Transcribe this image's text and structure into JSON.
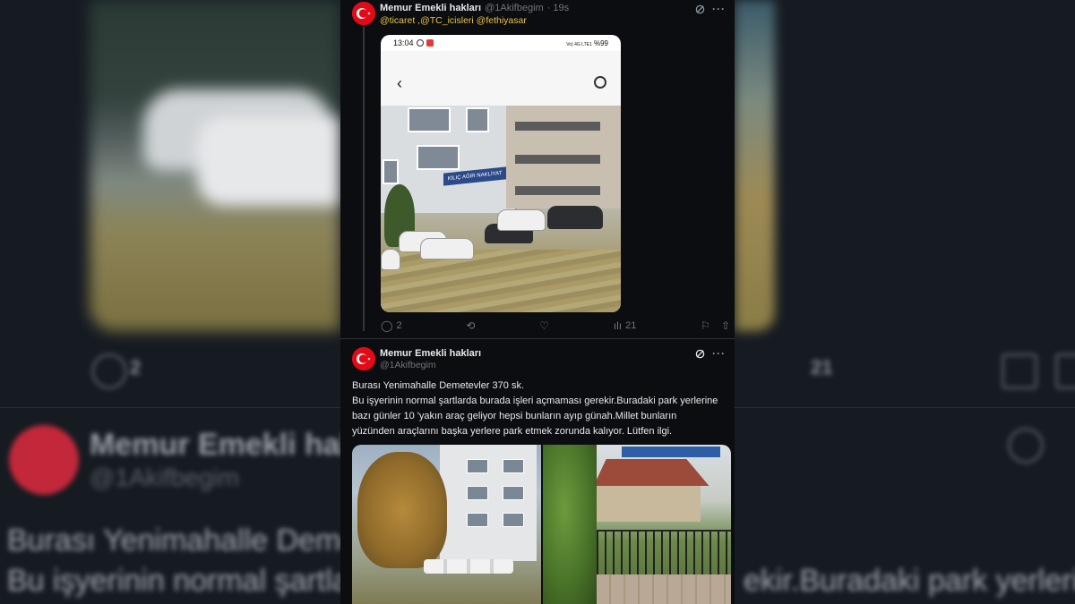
{
  "background": {
    "blur_name": "Memur Emekli hakl",
    "blur_handle": "@1Akifbegim",
    "blur_line1_left": "Burası Yenimahalle Deme",
    "blur_line2_left": "Bu işyerinin normal şartla",
    "blur_line1_right": "",
    "blur_line2_right": "ekir.Buradaki park yerlerine",
    "blur_reply_count": "2",
    "blur_views_count": "21"
  },
  "tweet1": {
    "author": "Memur Emekli hakları",
    "handle": "@1Akifbegim",
    "time": "· 19s",
    "mentions": "@ticaret ,@TC_icisleri @fethiyasar",
    "phone_time": "13:04",
    "phone_battery": "%99",
    "phone_signal": "Vo) 4G LTE1",
    "store_sign": "KILIÇ AĞIR NAKLİYAT",
    "replies": "2",
    "views": "21"
  },
  "tweet2": {
    "author": "Memur Emekli hakları",
    "handle": "@1Akifbegim",
    "lines": [
      "Burası Yenimahalle Demetevler 370 sk.",
      "Bu işyerinin normal şartlarda burada işleri açmaması gerekir.Buradaki park yerlerine",
      "bazı günler 10 'yakın araç geliyor hepsi bunların ayıp günah.Millet bunların",
      "yüzünden araçlarını başka yerlere park etmek zorunda kalıyor. Lütfen ilgi."
    ]
  },
  "icons": [
    "turkish-flag-avatar",
    "grok-icon",
    "more-icon",
    "reply-icon",
    "retweet-icon",
    "like-icon",
    "views-icon",
    "bookmark-icon",
    "share-icon",
    "back-arrow-icon",
    "camera-switch-icon"
  ],
  "colors": {
    "feed_bg": "#0b0d10",
    "mention": "#e8c547",
    "muted": "#71767b",
    "text": "#e7e9ea",
    "flag_red": "#e30a17"
  }
}
